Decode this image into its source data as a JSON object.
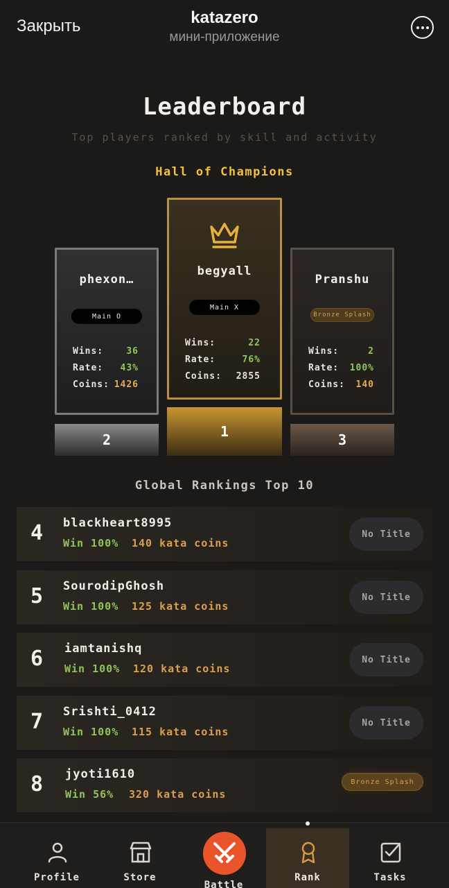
{
  "topbar": {
    "close_label": "Закрыть",
    "app_title": "katazero",
    "app_subtitle": "мини-приложение"
  },
  "header": {
    "title": "Leaderboard",
    "subtitle": "Top players ranked by skill and activity",
    "hall_label": "Hall of Champions"
  },
  "podium": {
    "stat_labels": {
      "wins": "Wins:",
      "rate": "Rate:",
      "coins": "Coins:"
    },
    "first": {
      "name": "begyall",
      "title": "Main X",
      "wins": "22",
      "rate": "76%",
      "coins": "2855",
      "place": "1"
    },
    "second": {
      "name": "phexon…",
      "title": "Main O",
      "wins": "36",
      "rate": "43%",
      "coins": "1426",
      "place": "2"
    },
    "third": {
      "name": "Pranshu",
      "title": "Bronze Splash",
      "wins": "2",
      "rate": "100%",
      "coins": "140",
      "place": "3"
    }
  },
  "rankings": {
    "title": "Global Rankings Top 10",
    "rows": [
      {
        "rank": "4",
        "name": "blackheart8995",
        "win": "Win 100%",
        "coins": "140 kata coins",
        "badge": "No Title"
      },
      {
        "rank": "5",
        "name": "SourodipGhosh",
        "win": "Win 100%",
        "coins": "125 kata coins",
        "badge": "No Title"
      },
      {
        "rank": "6",
        "name": "iamtanishq",
        "win": "Win 100%",
        "coins": "120 kata coins",
        "badge": "No Title"
      },
      {
        "rank": "7",
        "name": "Srishti_0412",
        "win": "Win 100%",
        "coins": "115 kata coins",
        "badge": "No Title"
      },
      {
        "rank": "8",
        "name": "jyoti1610",
        "win": "Win 56%",
        "coins": "320 kata coins",
        "badge": "Bronze Splash"
      }
    ]
  },
  "nav": {
    "items": [
      {
        "label": "Profile",
        "icon": "person-icon"
      },
      {
        "label": "Store",
        "icon": "store-icon"
      },
      {
        "label": "Battle",
        "icon": "crossed-swords-icon"
      },
      {
        "label": "Rank",
        "icon": "medal-icon"
      },
      {
        "label": "Tasks",
        "icon": "checkbox-icon"
      }
    ],
    "active": "Rank"
  },
  "colors": {
    "gold": "#f3c03a",
    "win_green": "#93c85b",
    "coins_orange": "#e3ac56",
    "battle_orange": "#e9542a",
    "background": "#1c1a19"
  }
}
